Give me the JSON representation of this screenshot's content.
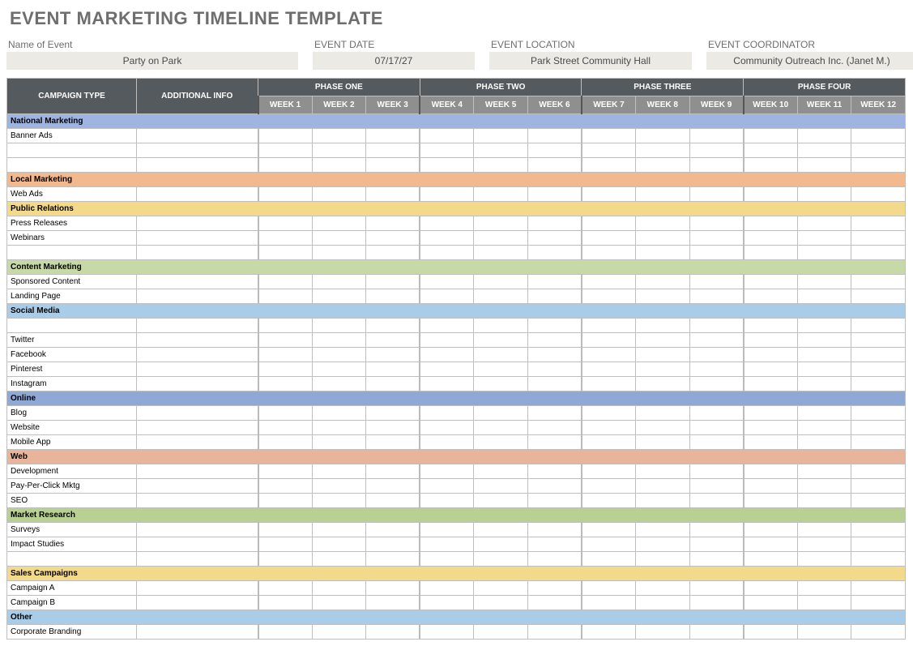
{
  "title": "EVENT MARKETING TIMELINE TEMPLATE",
  "info": {
    "name_label": "Name of Event",
    "name_value": "Party on Park",
    "date_label": "EVENT DATE",
    "date_value": "07/17/27",
    "loc_label": "EVENT LOCATION",
    "loc_value": "Park Street Community Hall",
    "coord_label": "EVENT COORDINATOR",
    "coord_value": "Community Outreach Inc. (Janet M.)"
  },
  "headers": {
    "campaign": "CAMPAIGN TYPE",
    "additional": "ADDITIONAL INFO",
    "phases": [
      "PHASE ONE",
      "PHASE TWO",
      "PHASE THREE",
      "PHASE FOUR"
    ],
    "weeks": [
      "WEEK 1",
      "WEEK 2",
      "WEEK 3",
      "WEEK 4",
      "WEEK 5",
      "WEEK 6",
      "WEEK 7",
      "WEEK 8",
      "WEEK 9",
      "WEEK 10",
      "WEEK 11",
      "WEEK 12"
    ]
  },
  "colors": {
    "nat": "f-blue",
    "loc": "f-orange",
    "pr": "f-yellow",
    "con": "f-green",
    "soc": "f-lblue",
    "onl": "f-blue2",
    "web": "f-orange",
    "mr": "f-green",
    "sc": "f-yellow",
    "oth": "f-lblue"
  },
  "sections": [
    {
      "name": "National Marketing",
      "cls": "c-nat",
      "color": "nat",
      "rows": [
        {
          "label": "Banner Ads",
          "cells": [
            1,
            0,
            1,
            0,
            1,
            0,
            1,
            0,
            1,
            0,
            1,
            0
          ]
        },
        {
          "label": "",
          "cells": [
            0,
            0,
            0,
            0,
            0,
            0,
            0,
            0,
            0,
            0,
            0,
            0
          ]
        }
      ],
      "blankAfter": true
    },
    {
      "name": "Local Marketing",
      "cls": "c-loc",
      "color": "loc",
      "rows": [
        {
          "label": "Web Ads",
          "cells": [
            0,
            1,
            1,
            1,
            1,
            1,
            0,
            1,
            1,
            0,
            0,
            1
          ]
        }
      ]
    },
    {
      "name": "Public Relations",
      "cls": "c-pr",
      "color": "pr",
      "rows": [
        {
          "label": "Press Releases",
          "cells": [
            1,
            0,
            0,
            1,
            0,
            0,
            1,
            0,
            0,
            0,
            0,
            1
          ]
        },
        {
          "label": "Webinars",
          "cells": [
            1,
            0,
            0,
            0,
            1,
            0,
            0,
            0,
            0,
            1,
            0,
            0
          ]
        }
      ],
      "blankAfter": true
    },
    {
      "name": "Content Marketing",
      "cls": "c-con",
      "color": "con",
      "rows": [
        {
          "label": "Sponsored Content",
          "cells": [
            0,
            0,
            1,
            0,
            0,
            0,
            1,
            1,
            0,
            0,
            1,
            0
          ]
        },
        {
          "label": "Landing Page",
          "cells": [
            0,
            1,
            1,
            0,
            1,
            1,
            0,
            1,
            1,
            0,
            1,
            1
          ]
        }
      ]
    },
    {
      "name": "Social Media",
      "cls": "c-soc",
      "color": "soc",
      "rows": [
        {
          "label": "",
          "cells": [
            0,
            0,
            0,
            0,
            0,
            0,
            0,
            0,
            0,
            0,
            0,
            0
          ]
        },
        {
          "label": "Twitter",
          "cells": [
            1,
            1,
            1,
            1,
            1,
            1,
            1,
            1,
            1,
            1,
            1,
            1
          ]
        },
        {
          "label": "Facebook",
          "cells": [
            1,
            1,
            1,
            0,
            1,
            1,
            1,
            0,
            1,
            1,
            1,
            0
          ]
        },
        {
          "label": "Pinterest",
          "cells": [
            0,
            1,
            1,
            1,
            0,
            1,
            1,
            1,
            0,
            1,
            1,
            1
          ]
        },
        {
          "label": "Instagram",
          "cells": [
            0,
            0,
            0,
            0,
            0,
            0,
            0,
            0,
            0,
            0,
            0,
            0
          ]
        }
      ]
    },
    {
      "name": "Online",
      "cls": "c-onl",
      "color": "onl",
      "rows": [
        {
          "label": "Blog",
          "cells": [
            1,
            1,
            1,
            1,
            1,
            1,
            1,
            1,
            1,
            1,
            1,
            1
          ]
        },
        {
          "label": "Website",
          "cells": [
            1,
            0,
            1,
            0,
            1,
            1,
            1,
            1,
            0,
            1,
            0,
            1
          ]
        },
        {
          "label": "Mobile App",
          "cells": [
            0,
            1,
            1,
            0,
            1,
            1,
            0,
            1,
            1,
            0,
            1,
            1
          ]
        }
      ]
    },
    {
      "name": "Web",
      "cls": "c-web",
      "color": "web",
      "rows": [
        {
          "label": "Development",
          "cells": [
            1,
            1,
            0,
            0,
            0,
            0,
            0,
            0,
            0,
            0,
            0,
            0
          ]
        },
        {
          "label": "Pay-Per-Click Mktg",
          "cells": [
            0,
            0,
            0,
            1,
            1,
            1,
            1,
            1,
            1,
            1,
            0,
            0
          ]
        },
        {
          "label": "SEO",
          "cells": [
            0,
            1,
            1,
            0,
            0,
            0,
            0,
            0,
            0,
            0,
            0,
            0
          ]
        }
      ]
    },
    {
      "name": "Market Research",
      "cls": "c-mr",
      "color": "mr",
      "rows": [
        {
          "label": "Surveys",
          "cells": [
            0,
            0,
            1,
            0,
            0,
            0,
            1,
            1,
            0,
            1,
            0,
            0
          ]
        },
        {
          "label": "Impact Studies",
          "cells": [
            0,
            0,
            0,
            0,
            0,
            1,
            1,
            1,
            1,
            0,
            0,
            0
          ]
        }
      ],
      "blankAfter": true
    },
    {
      "name": "Sales Campaigns",
      "cls": "c-sc",
      "color": "sc",
      "rows": [
        {
          "label": "Campaign A",
          "cells": [
            1,
            0,
            0,
            0,
            0,
            0,
            1,
            0,
            0,
            0,
            0,
            0
          ]
        },
        {
          "label": "Campaign B",
          "cells": [
            0,
            0,
            0,
            1,
            1,
            1,
            1,
            0,
            0,
            0,
            0,
            0
          ]
        }
      ]
    },
    {
      "name": "Other",
      "cls": "c-oth",
      "color": "oth",
      "rows": [
        {
          "label": "Corporate Branding",
          "cells": [
            0,
            1,
            1,
            1,
            1,
            0,
            0,
            0,
            0,
            0,
            0,
            0
          ]
        }
      ]
    }
  ]
}
